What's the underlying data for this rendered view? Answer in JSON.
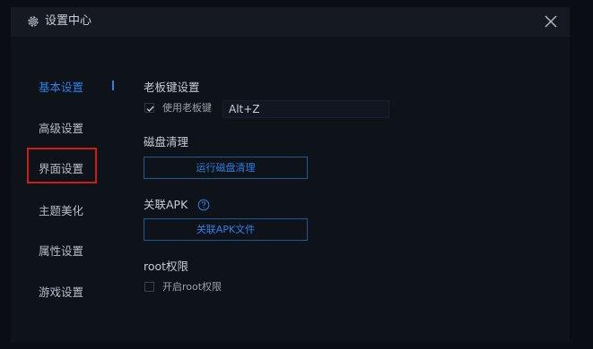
{
  "window": {
    "title": "设置中心",
    "icons": {
      "title": "gear-icon",
      "close": "close-icon",
      "help": "question-circle-icon",
      "check": "checkmark-icon"
    }
  },
  "colors": {
    "accent": "#2f7fe6",
    "highlight": "#d11a1a",
    "background": "#0e1219"
  },
  "sidebar": {
    "items": [
      {
        "label": "基本设置",
        "active": true
      },
      {
        "label": "高级设置",
        "active": false
      },
      {
        "label": "界面设置",
        "active": false,
        "highlighted": true
      },
      {
        "label": "主题美化",
        "active": false
      },
      {
        "label": "属性设置",
        "active": false
      },
      {
        "label": "游戏设置",
        "active": false
      }
    ]
  },
  "boss_key": {
    "section_label": "老板键设置",
    "checkbox_label": "使用老板键",
    "checked": true,
    "hotkey_value": "Alt+Z"
  },
  "disk_cleanup": {
    "section_label": "磁盘清理",
    "button_label": "运行磁盘清理"
  },
  "associate_apk": {
    "section_label": "关联APK",
    "button_label": "关联APK文件"
  },
  "root": {
    "section_label": "root权限",
    "checkbox_label": "开启root权限",
    "checked": false
  }
}
